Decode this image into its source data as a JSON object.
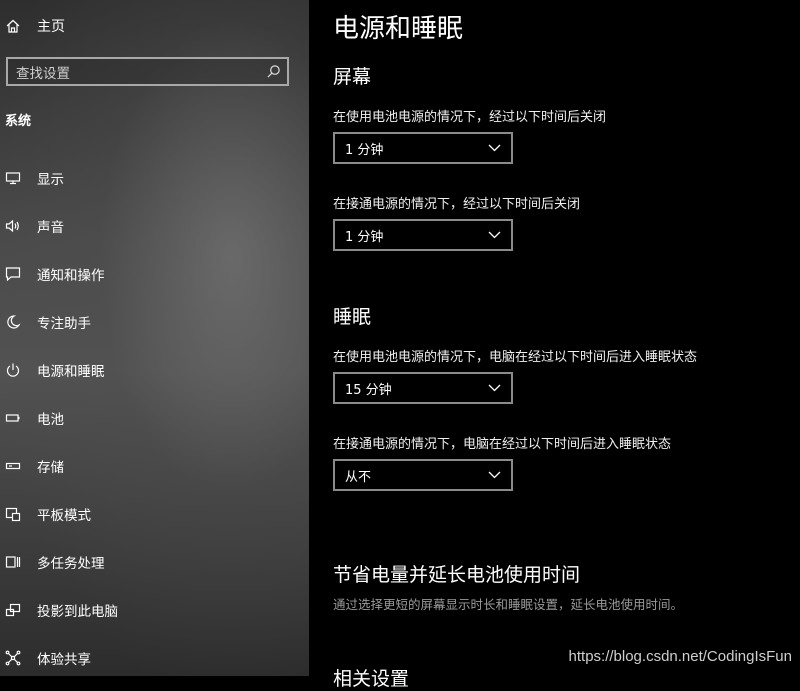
{
  "sidebar": {
    "home_label": "主页",
    "search_placeholder": "查找设置",
    "section_label": "系统",
    "items": [
      {
        "label": "显示",
        "icon": "monitor-icon"
      },
      {
        "label": "声音",
        "icon": "speaker-icon"
      },
      {
        "label": "通知和操作",
        "icon": "notification-icon"
      },
      {
        "label": "专注助手",
        "icon": "moon-icon"
      },
      {
        "label": "电源和睡眠",
        "icon": "power-icon"
      },
      {
        "label": "电池",
        "icon": "battery-icon"
      },
      {
        "label": "存储",
        "icon": "storage-icon"
      },
      {
        "label": "平板模式",
        "icon": "tablet-mode-icon"
      },
      {
        "label": "多任务处理",
        "icon": "multitasking-icon"
      },
      {
        "label": "投影到此电脑",
        "icon": "project-icon"
      },
      {
        "label": "体验共享",
        "icon": "share-icon"
      }
    ]
  },
  "main": {
    "title": "电源和睡眠",
    "screen": {
      "heading": "屏幕",
      "battery_label": "在使用电池电源的情况下，经过以下时间后关闭",
      "battery_value": "1 分钟",
      "plugged_label": "在接通电源的情况下，经过以下时间后关闭",
      "plugged_value": "1 分钟"
    },
    "sleep": {
      "heading": "睡眠",
      "battery_label": "在使用电池电源的情况下，电脑在经过以下时间后进入睡眠状态",
      "battery_value": "15 分钟",
      "plugged_label": "在接通电源的情况下，电脑在经过以下时间后进入睡眠状态",
      "plugged_value": "从不"
    },
    "save_power": {
      "heading": "节省电量并延长电池使用时间",
      "description": "通过选择更短的屏幕显示时长和睡眠设置，延长电池使用时间。"
    },
    "related_heading_partial": "相关设置"
  },
  "watermark": "https://blog.csdn.net/CodingIsFun"
}
